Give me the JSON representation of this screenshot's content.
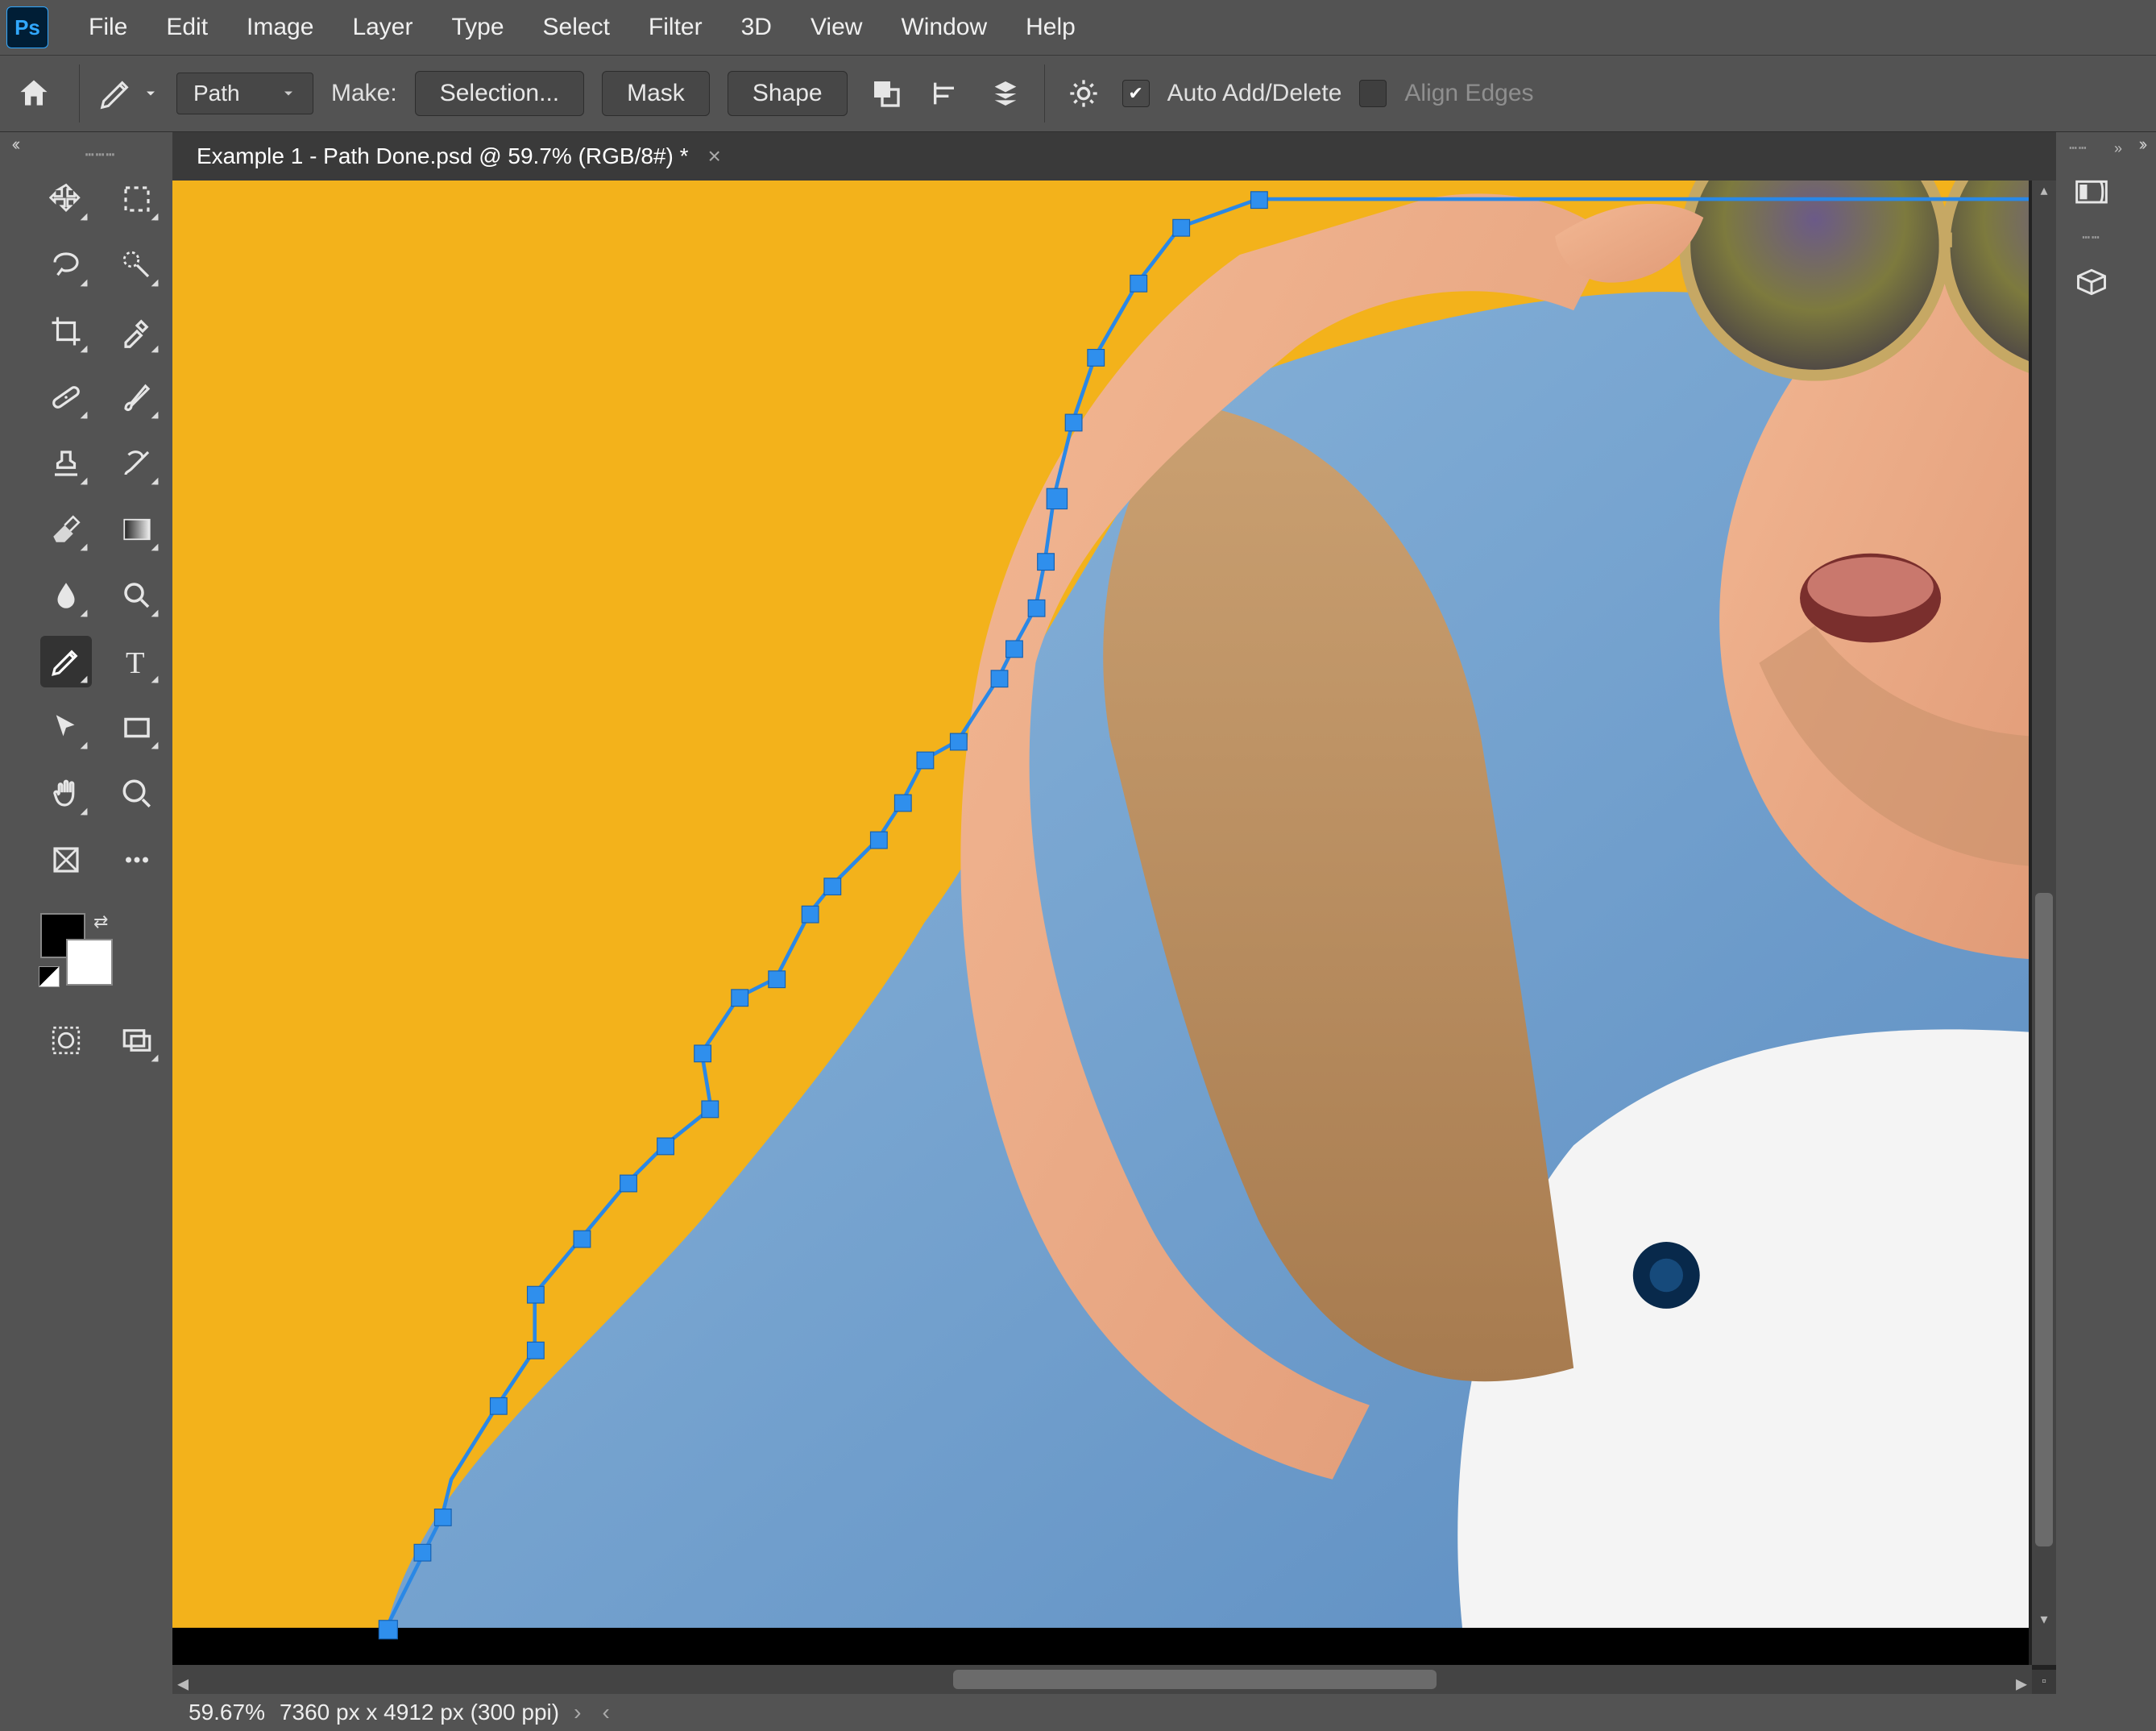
{
  "app": {
    "logo": "Ps"
  },
  "menu": {
    "items": [
      "File",
      "Edit",
      "Image",
      "Layer",
      "Type",
      "Select",
      "Filter",
      "3D",
      "View",
      "Window",
      "Help"
    ]
  },
  "options": {
    "mode_selected": "Path",
    "make_label": "Make:",
    "selection_btn": "Selection...",
    "mask_btn": "Mask",
    "shape_btn": "Shape",
    "auto_add_delete_label": "Auto Add/Delete",
    "auto_add_delete_checked": true,
    "align_edges_label": "Align Edges",
    "align_edges_checked": false
  },
  "document": {
    "tab_title": "Example 1 - Path Done.psd @ 59.7% (RGB/8#) *",
    "tab_close": "×"
  },
  "status": {
    "zoom": "59.67%",
    "dims": "7360 px x 4912 px (300 ppi)",
    "chevron": "›",
    "left_arrow": "‹"
  },
  "canvas": {
    "bg_yellow": "#f3b21b",
    "path_color": "#2a88e6",
    "anchor_fill": "#2f8fed"
  },
  "tool_names": [
    "move-tool",
    "marquee-tool",
    "lasso-tool",
    "quick-select-tool",
    "crop-tool",
    "eyedropper-tool",
    "spot-heal-tool",
    "brush-tool",
    "clone-stamp-tool",
    "history-brush-tool",
    "eraser-tool",
    "gradient-tool",
    "blur-tool",
    "dodge-tool",
    "pen-tool",
    "type-tool",
    "path-select-tool",
    "rectangle-tool",
    "hand-tool",
    "zoom-tool",
    "artboard-tool",
    "more-tool"
  ],
  "bottom_tool_names": [
    "quick-mask-tool",
    "screen-mode-tool"
  ]
}
